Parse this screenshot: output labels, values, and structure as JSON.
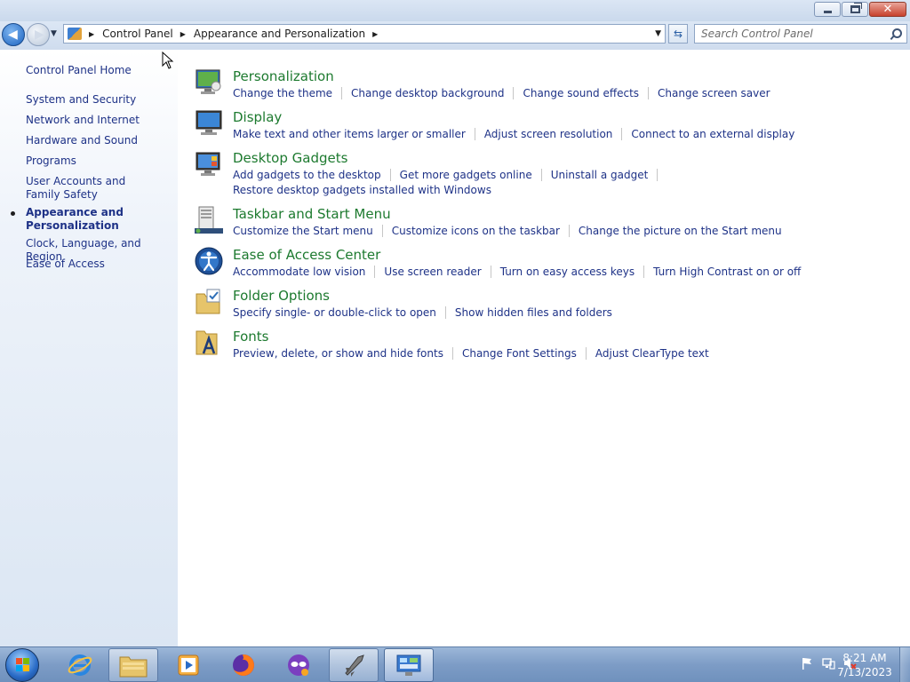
{
  "window": {
    "buttons": {
      "minimize": "minimize",
      "maximize": "restore",
      "close": "close"
    }
  },
  "navigation": {
    "breadcrumbs": [
      "Control Panel",
      "Appearance and Personalization"
    ],
    "search_placeholder": "Search Control Panel"
  },
  "sidebar": {
    "items": [
      {
        "label": "Control Panel Home"
      },
      {
        "label": "System and Security"
      },
      {
        "label": "Network and Internet"
      },
      {
        "label": "Hardware and Sound"
      },
      {
        "label": "Programs"
      },
      {
        "label": "User Accounts and Family Safety"
      },
      {
        "label": "Appearance and Personalization",
        "current": true
      },
      {
        "label": "Clock, Language, and Region"
      },
      {
        "label": "Ease of Access"
      }
    ]
  },
  "categories": [
    {
      "title": "Personalization",
      "icon": "personalization-icon",
      "rows": [
        [
          "Change the theme",
          "Change desktop background",
          "Change sound effects",
          "Change screen saver"
        ]
      ]
    },
    {
      "title": "Display",
      "icon": "display-icon",
      "rows": [
        [
          "Make text and other items larger or smaller",
          "Adjust screen resolution",
          "Connect to an external display"
        ]
      ]
    },
    {
      "title": "Desktop Gadgets",
      "icon": "gadgets-icon",
      "rows": [
        [
          "Add gadgets to the desktop",
          "Get more gadgets online",
          "Uninstall a gadget"
        ],
        [
          "Restore desktop gadgets installed with Windows"
        ]
      ]
    },
    {
      "title": "Taskbar and Start Menu",
      "icon": "taskbar-icon",
      "rows": [
        [
          "Customize the Start menu",
          "Customize icons on the taskbar",
          "Change the picture on the Start menu"
        ]
      ]
    },
    {
      "title": "Ease of Access Center",
      "icon": "ease-of-access-icon",
      "rows": [
        [
          "Accommodate low vision",
          "Use screen reader",
          "Turn on easy access keys",
          "Turn High Contrast on or off"
        ]
      ]
    },
    {
      "title": "Folder Options",
      "icon": "folder-options-icon",
      "rows": [
        [
          "Specify single- or double-click to open",
          "Show hidden files and folders"
        ]
      ]
    },
    {
      "title": "Fonts",
      "icon": "fonts-icon",
      "rows": [
        [
          "Preview, delete, or show and hide fonts",
          "Change Font Settings",
          "Adjust ClearType text"
        ]
      ]
    }
  ],
  "taskbar": {
    "apps": [
      "internet-explorer-icon",
      "file-explorer-icon",
      "media-player-icon",
      "firefox-icon",
      "tor-browser-icon",
      "rocket-app-icon",
      "control-panel-icon"
    ],
    "clock": {
      "time": "8:21 AM",
      "date": "7/13/2023"
    }
  },
  "colors": {
    "link": "#1e3287",
    "category_title": "#1d7a2f",
    "sidebar_bg": "#dbe6f3"
  }
}
